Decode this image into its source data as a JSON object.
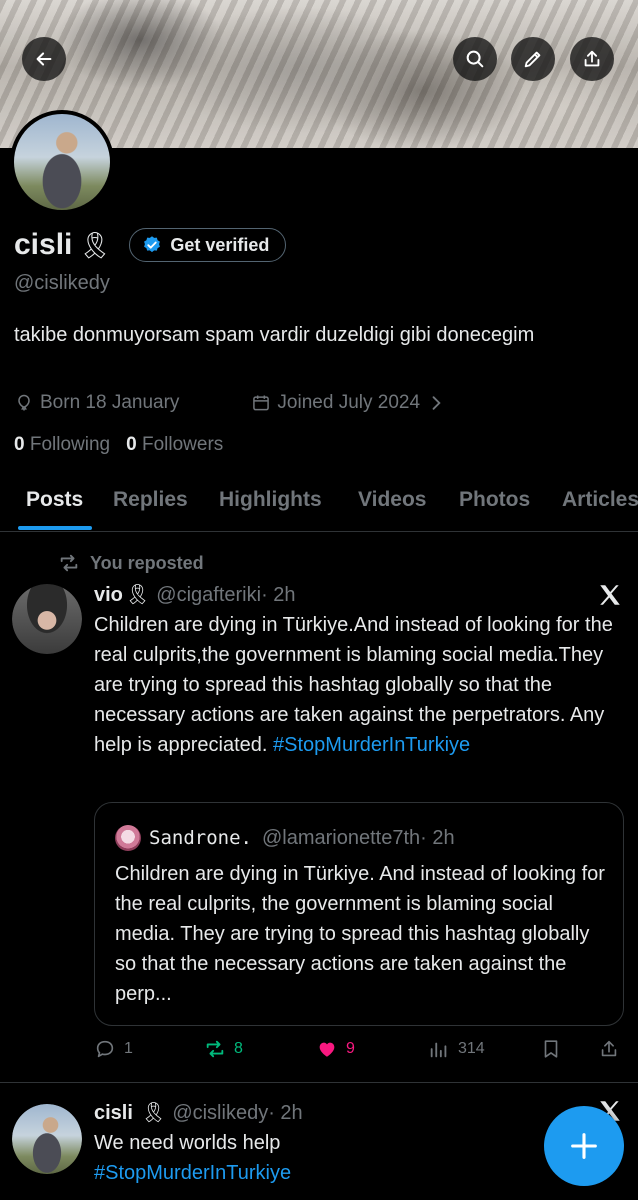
{
  "header": {
    "back_icon": "arrow-left-icon",
    "search_icon": "search-icon",
    "edit_icon": "pencil-icon",
    "share_icon": "share-icon"
  },
  "profile": {
    "display_name": "cisli",
    "ribbon": "🎗",
    "verify_label": "Get verified",
    "handle": "@cislikedy",
    "bio": "takibe donmuyorsam spam vardir duzeldigi gibi donecegim",
    "born": "Born 18 January",
    "joined": "Joined July 2024",
    "following_count": "0",
    "following_label": "Following",
    "followers_count": "0",
    "followers_label": "Followers"
  },
  "tabs": [
    {
      "label": "Posts",
      "active": true
    },
    {
      "label": "Replies",
      "active": false
    },
    {
      "label": "Highlights",
      "active": false
    },
    {
      "label": "Videos",
      "active": false
    },
    {
      "label": "Photos",
      "active": false
    },
    {
      "label": "Articles",
      "active": false
    }
  ],
  "posts": [
    {
      "repost_label": "You reposted",
      "name": "vio",
      "ribbon": "🎗",
      "handle": "@cigafteriki",
      "time": "· 2h",
      "text": "Children are dying in Türkiye.And instead of looking for the real culprits,the government is blaming social media.They are trying to spread this hashtag globally so that the necessary actions are taken against the perpetrators. Any help is appreciated.",
      "hashtag": "#StopMurderInTurkiye",
      "quote": {
        "name": "Sandrone.",
        "handle": "@lamarionette7th",
        "time": "· 2h",
        "text": "Children are dying in Türkiye. And instead of looking for the real culprits, the government is blaming social media. They are trying to spread this hashtag globally so that the necessary actions are taken against the perp..."
      },
      "actions": {
        "replies": "1",
        "reposts": "8",
        "likes": "9",
        "views": "314"
      }
    },
    {
      "name": "cisli",
      "ribbon": "🎗",
      "handle": "@cislikedy",
      "time": "· 2h",
      "text": "We need worlds help",
      "hashtag": "#StopMurderInTurkiye"
    }
  ],
  "colors": {
    "accent": "#1d9bf0",
    "repost_green": "#00ba7c",
    "like_pink": "#f91880",
    "muted": "#71767b"
  }
}
